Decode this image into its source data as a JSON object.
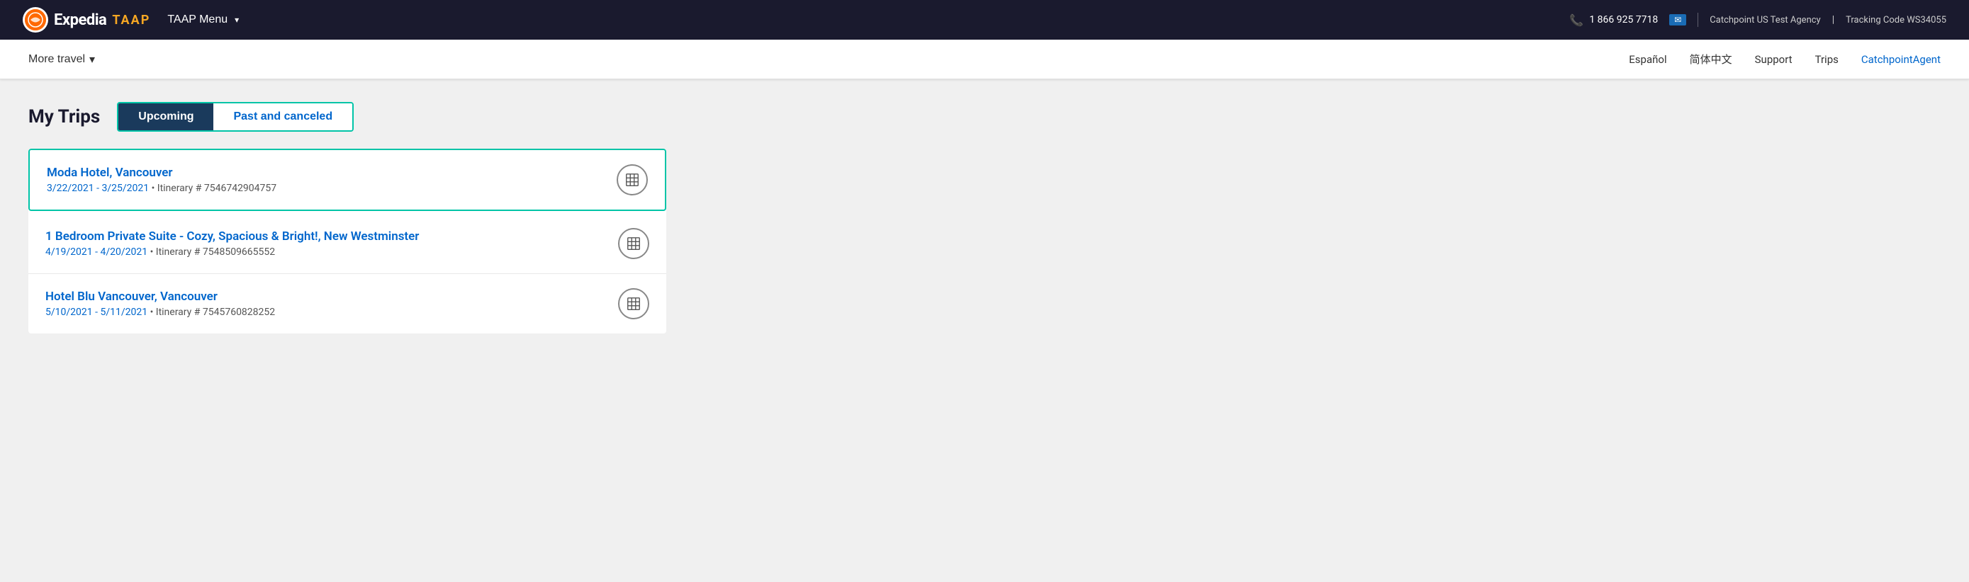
{
  "topBar": {
    "logoText": "E",
    "brandName": "Expedia",
    "taapLabel": "TAAP",
    "menuLabel": "TAAP Menu",
    "phone": "1 866 925 7718",
    "agencyName": "Catchpoint US Test Agency",
    "trackingCode": "Tracking Code WS34055"
  },
  "secondaryNav": {
    "moreTravelLabel": "More travel",
    "links": [
      {
        "label": "Español"
      },
      {
        "label": "简体中文"
      },
      {
        "label": "Support"
      },
      {
        "label": "Trips"
      },
      {
        "label": "CatchpointAgent"
      }
    ]
  },
  "myTrips": {
    "title": "My Trips",
    "tabs": [
      {
        "label": "Upcoming",
        "active": true
      },
      {
        "label": "Past and canceled",
        "active": false
      }
    ],
    "trips": [
      {
        "name": "Moda Hotel, Vancouver",
        "dates": "3/22/2021 - 3/25/2021",
        "itinerary": "Itinerary # 7546742904757",
        "highlighted": true
      },
      {
        "name": "1 Bedroom Private Suite - Cozy, Spacious & Bright!, New Westminster",
        "dates": "4/19/2021 - 4/20/2021",
        "itinerary": "Itinerary # 7548509665552",
        "highlighted": false
      },
      {
        "name": "Hotel Blu Vancouver, Vancouver",
        "dates": "5/10/2021 - 5/11/2021",
        "itinerary": "Itinerary # 7545760828252",
        "highlighted": false
      }
    ]
  }
}
